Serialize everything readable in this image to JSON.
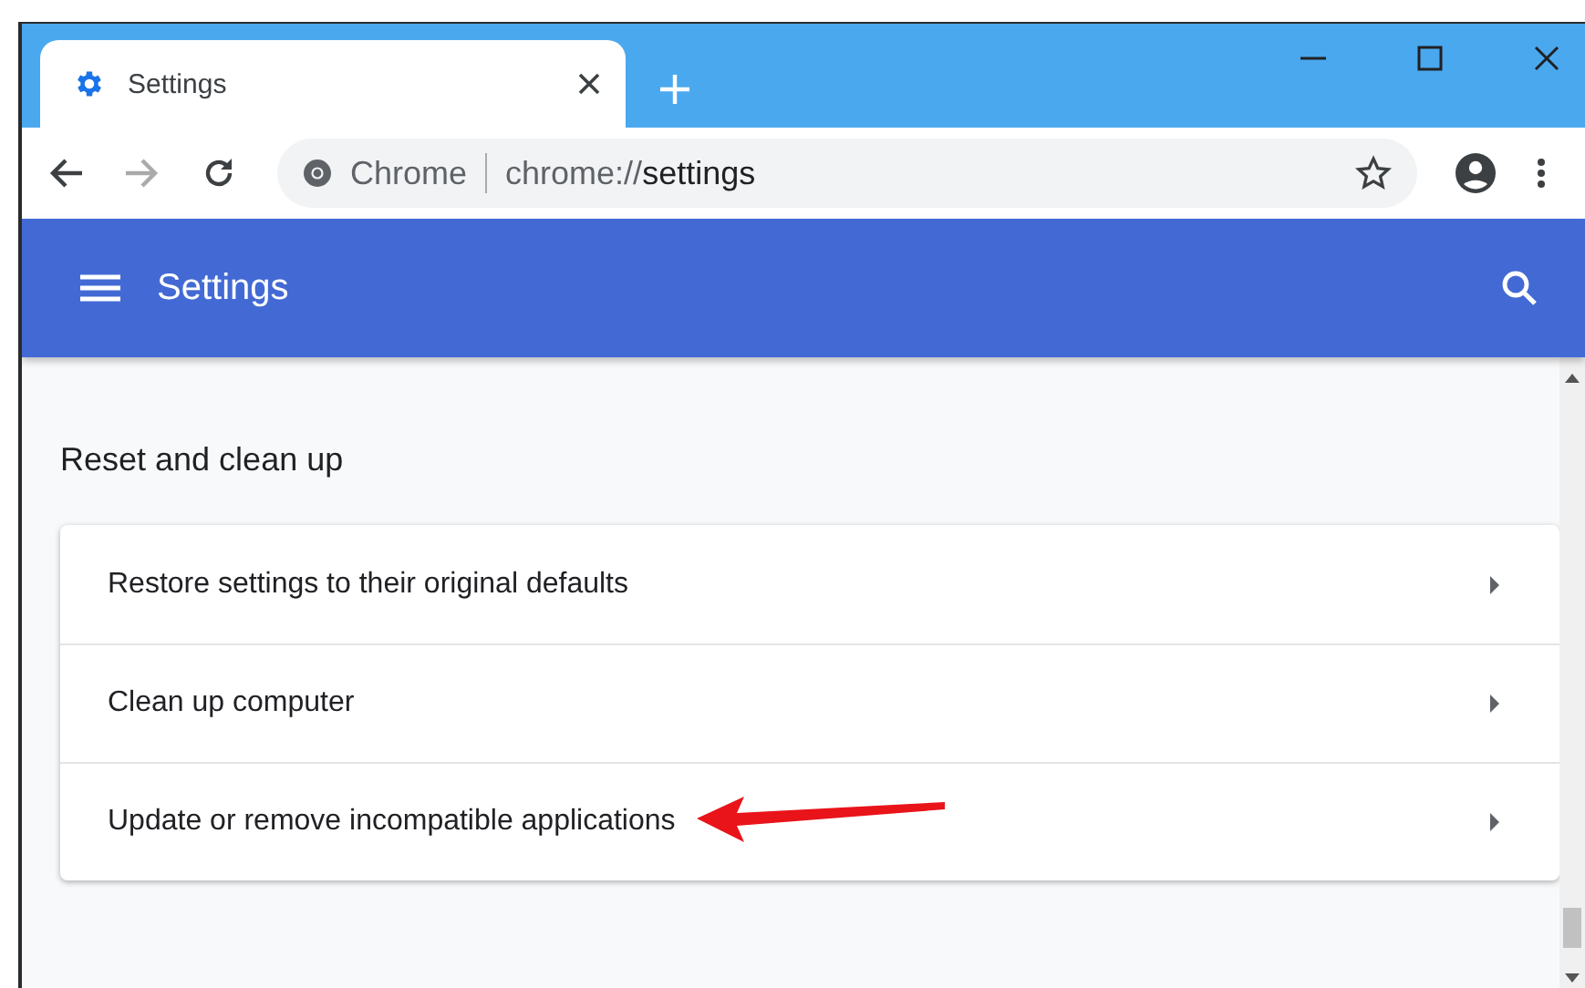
{
  "tab": {
    "title": "Settings"
  },
  "address_bar": {
    "origin_label": "Chrome",
    "url_prefix": "chrome://",
    "url_path": "settings"
  },
  "header": {
    "title": "Settings"
  },
  "section": {
    "title": "Reset and clean up",
    "items": [
      {
        "label": "Restore settings to their original defaults",
        "highlighted": false
      },
      {
        "label": "Clean up computer",
        "highlighted": false
      },
      {
        "label": "Update or remove incompatible applications",
        "highlighted": true
      }
    ]
  }
}
